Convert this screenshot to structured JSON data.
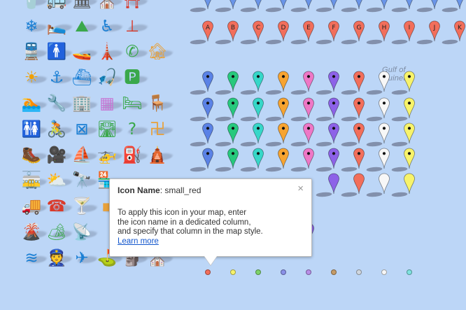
{
  "infowindow": {
    "title_label": "Icon Name",
    "title_value": "small_red",
    "body_lines": [
      "To apply this icon in your map, enter",
      "the icon name in a dedicated column,",
      "and specify that column in the map style."
    ],
    "link_text": "Learn more",
    "close_icon": "×"
  },
  "map": {
    "place_label_line1": "Gulf of",
    "place_label_line2": "Guinea"
  },
  "letter_markers": {
    "letters": [
      "A",
      "B",
      "C",
      "D",
      "E",
      "F",
      "G",
      "H",
      "I",
      "J",
      "K"
    ],
    "row1_color": "#6a95e8",
    "row2_color": "#f26e5b"
  },
  "pin_columns": [
    {
      "name": "blue",
      "color": "#5a82e6"
    },
    {
      "name": "green",
      "color": "#27c97d"
    },
    {
      "name": "teal",
      "color": "#36d7c8"
    },
    {
      "name": "orange",
      "color": "#f7a431"
    },
    {
      "name": "pink",
      "color": "#ee77c6"
    },
    {
      "name": "purple",
      "color": "#8d62e8"
    },
    {
      "name": "red",
      "color": "#f26e5b"
    },
    {
      "name": "white",
      "color": "#f7f7f7"
    },
    {
      "name": "yellow",
      "color": "#f7f36b"
    }
  ],
  "small_dots": [
    {
      "name": "small_red",
      "color": "#f26e5b"
    },
    {
      "name": "small_yellow",
      "color": "#f7f36b"
    },
    {
      "name": "small_green",
      "color": "#7ed36a"
    },
    {
      "name": "small_blue",
      "color": "#8a91e8"
    },
    {
      "name": "small_purple",
      "color": "#b88ee8"
    },
    {
      "name": "small_brown",
      "color": "#c59b67"
    },
    {
      "name": "small_gray",
      "color": "#d0d7df"
    },
    {
      "name": "small_white",
      "color": "#f7f7f7"
    },
    {
      "name": "small_teal",
      "color": "#7fe3e0"
    }
  ],
  "icon_grid": [
    [
      "fast-food-icon",
      "bus-icon",
      "museum-icon",
      "church-icon",
      "torii-icon"
    ],
    [
      "snowflake-icon",
      "lodging-icon",
      "mountains-icon",
      "wheelchair-icon",
      "placeholder-red-icon"
    ],
    [
      "train-icon",
      "man-icon",
      "boat-icon",
      "lighthouse-icon",
      "phone-icon",
      "ruins-icon"
    ],
    [
      "sun-icon",
      "anchor-icon",
      "ferry-icon",
      "fishing-icon",
      "parking-icon"
    ],
    [
      "swimming-icon",
      "wrench-icon",
      "building-icon",
      "blocks-icon",
      "bed-icon",
      "sitting-icon"
    ],
    [
      "toilets-icon",
      "cyclist-icon",
      "x-box-icon",
      "highway-icon",
      "help-icon",
      "swastika-icon"
    ],
    [
      "hiking-icon",
      "movie-icon",
      "sailing-icon",
      "helicopter-icon",
      "gas-icon",
      "temple-icon"
    ],
    [
      "tram-icon",
      "partly-cloudy-icon",
      "binoculars-icon",
      "shop-icon"
    ],
    [
      "truck-icon",
      "payphone-icon",
      "bar-icon",
      "marker-small-icon"
    ],
    [
      "volcano-icon",
      "picnic-icon",
      "tower-icon"
    ],
    [
      "waves-icon",
      "police-icon",
      "airplane-icon",
      "golf-icon",
      "monument-icon",
      "chapel-icon"
    ]
  ],
  "icon_glyphs": {
    "fast-food-icon": "🥤",
    "bus-icon": "🚌",
    "museum-icon": "🏛",
    "church-icon": "⛪",
    "torii-icon": "⛩",
    "snowflake-icon": "❄",
    "lodging-icon": "🛌",
    "mountains-icon": "⛰",
    "wheelchair-icon": "♿",
    "placeholder-red-icon": "⊥",
    "train-icon": "🚆",
    "man-icon": "🚹",
    "boat-icon": "🚤",
    "lighthouse-icon": "🗼",
    "phone-icon": "✆",
    "ruins-icon": "🏚",
    "sun-icon": "☀",
    "anchor-icon": "⚓",
    "ferry-icon": "⛴",
    "fishing-icon": "🎣",
    "parking-icon": "🅿",
    "swimming-icon": "🏊",
    "wrench-icon": "🔧",
    "building-icon": "🏢",
    "blocks-icon": "▦",
    "bed-icon": "🛏",
    "sitting-icon": "🪑",
    "toilets-icon": "🚻",
    "cyclist-icon": "🚴",
    "x-box-icon": "⊠",
    "highway-icon": "🛣",
    "help-icon": "?",
    "swastika-icon": "卍",
    "hiking-icon": "🥾",
    "movie-icon": "🎥",
    "sailing-icon": "⛵",
    "helicopter-icon": "🚁",
    "gas-icon": "⛽",
    "temple-icon": "🛕",
    "tram-icon": "🚋",
    "partly-cloudy-icon": "⛅",
    "binoculars-icon": "🔭",
    "shop-icon": "🏪",
    "truck-icon": "🚚",
    "payphone-icon": "☎",
    "bar-icon": "🍸",
    "marker-small-icon": "▪",
    "volcano-icon": "🌋",
    "picnic-icon": "🏕",
    "tower-icon": "📡",
    "waves-icon": "≋",
    "police-icon": "👮",
    "airplane-icon": "✈",
    "golf-icon": "⛳",
    "monument-icon": "🗿",
    "chapel-icon": "⛪"
  },
  "icon_colors": {
    "fast-food-icon": "#6b6b6b",
    "bus-icon": "#1a7fd4",
    "museum-icon": "#555",
    "church-icon": "#3aa84b",
    "torii-icon": "#d93a2b",
    "snowflake-icon": "#1a7fd4",
    "lodging-icon": "#d93a2b",
    "mountains-icon": "#3aa84b",
    "wheelchair-icon": "#1a7fd4",
    "placeholder-red-icon": "#d93a2b",
    "train-icon": "#1a7fd4",
    "man-icon": "#333",
    "boat-icon": "#1a7fd4",
    "lighthouse-icon": "#1a7fd4",
    "phone-icon": "#3aa84b",
    "ruins-icon": "#e8a13a",
    "sun-icon": "#f0a000",
    "anchor-icon": "#1a7fd4",
    "ferry-icon": "#1a7fd4",
    "fishing-icon": "#1a7fd4",
    "parking-icon": "#3aa84b",
    "swimming-icon": "#1a7fd4",
    "wrench-icon": "#555",
    "building-icon": "#3aa84b",
    "blocks-icon": "#c678d4",
    "bed-icon": "#3aa84b",
    "sitting-icon": "#e8a13a",
    "toilets-icon": "#3aa84b",
    "cyclist-icon": "#3aa84b",
    "x-box-icon": "#1a7fd4",
    "highway-icon": "#3aa84b",
    "help-icon": "#3aa84b",
    "swastika-icon": "#e8a13a",
    "hiking-icon": "#3aa84b",
    "movie-icon": "#e8c13a",
    "sailing-icon": "#1a7fd4",
    "helicopter-icon": "#1a7fd4",
    "gas-icon": "#3aa84b",
    "temple-icon": "#e8a13a",
    "tram-icon": "#1a7fd4",
    "partly-cloudy-icon": "#f0a000",
    "binoculars-icon": "#3aa84b",
    "shop-icon": "#e8a13a",
    "truck-icon": "#1a7fd4",
    "payphone-icon": "#d93a2b",
    "bar-icon": "#555",
    "marker-small-icon": "#e8a13a",
    "volcano-icon": "#d93a2b",
    "picnic-icon": "#3aa84b",
    "tower-icon": "#3aa84b",
    "waves-icon": "#1a7fd4",
    "police-icon": "#1a4a7f",
    "airplane-icon": "#1a7fd4",
    "golf-icon": "#3aa84b",
    "monument-icon": "#3aa84b",
    "chapel-icon": "#e8a13a"
  }
}
